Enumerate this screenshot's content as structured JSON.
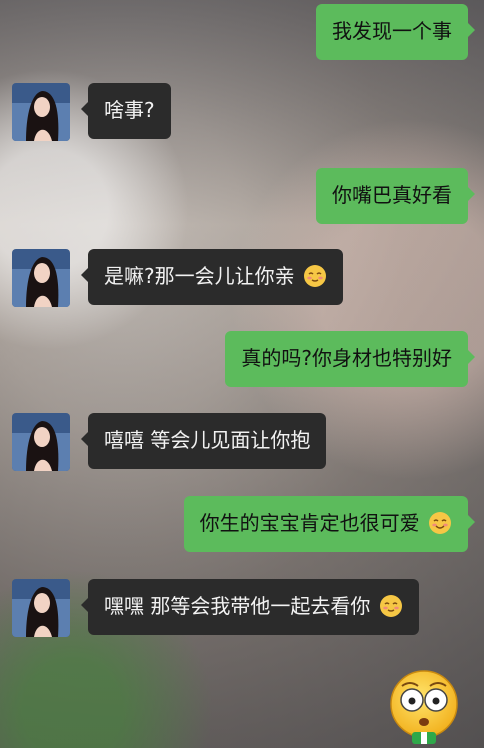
{
  "messages": [
    {
      "side": "sent",
      "text": "我发现一个事"
    },
    {
      "side": "recv",
      "text": "啥事?"
    },
    {
      "side": "sent",
      "text": "你嘴巴真好看"
    },
    {
      "side": "recv",
      "text": "是嘛?那一会儿让你亲",
      "emoji": "blush-emoji"
    },
    {
      "side": "sent",
      "text": "真的吗?你身材也特别好"
    },
    {
      "side": "recv",
      "text": "嘻嘻 等会儿见面让你抱"
    },
    {
      "side": "sent",
      "text": "你生的宝宝肯定也很可爱",
      "emoji": "smile-emoji"
    },
    {
      "side": "recv",
      "text": "嘿嘿 那等会我带他一起去看你",
      "emoji": "blush-emoji"
    }
  ],
  "colors": {
    "sent_bubble": "#5cbb5c",
    "recv_bubble": "#2b2b2b"
  },
  "sticker": "shocked-face-emoji"
}
